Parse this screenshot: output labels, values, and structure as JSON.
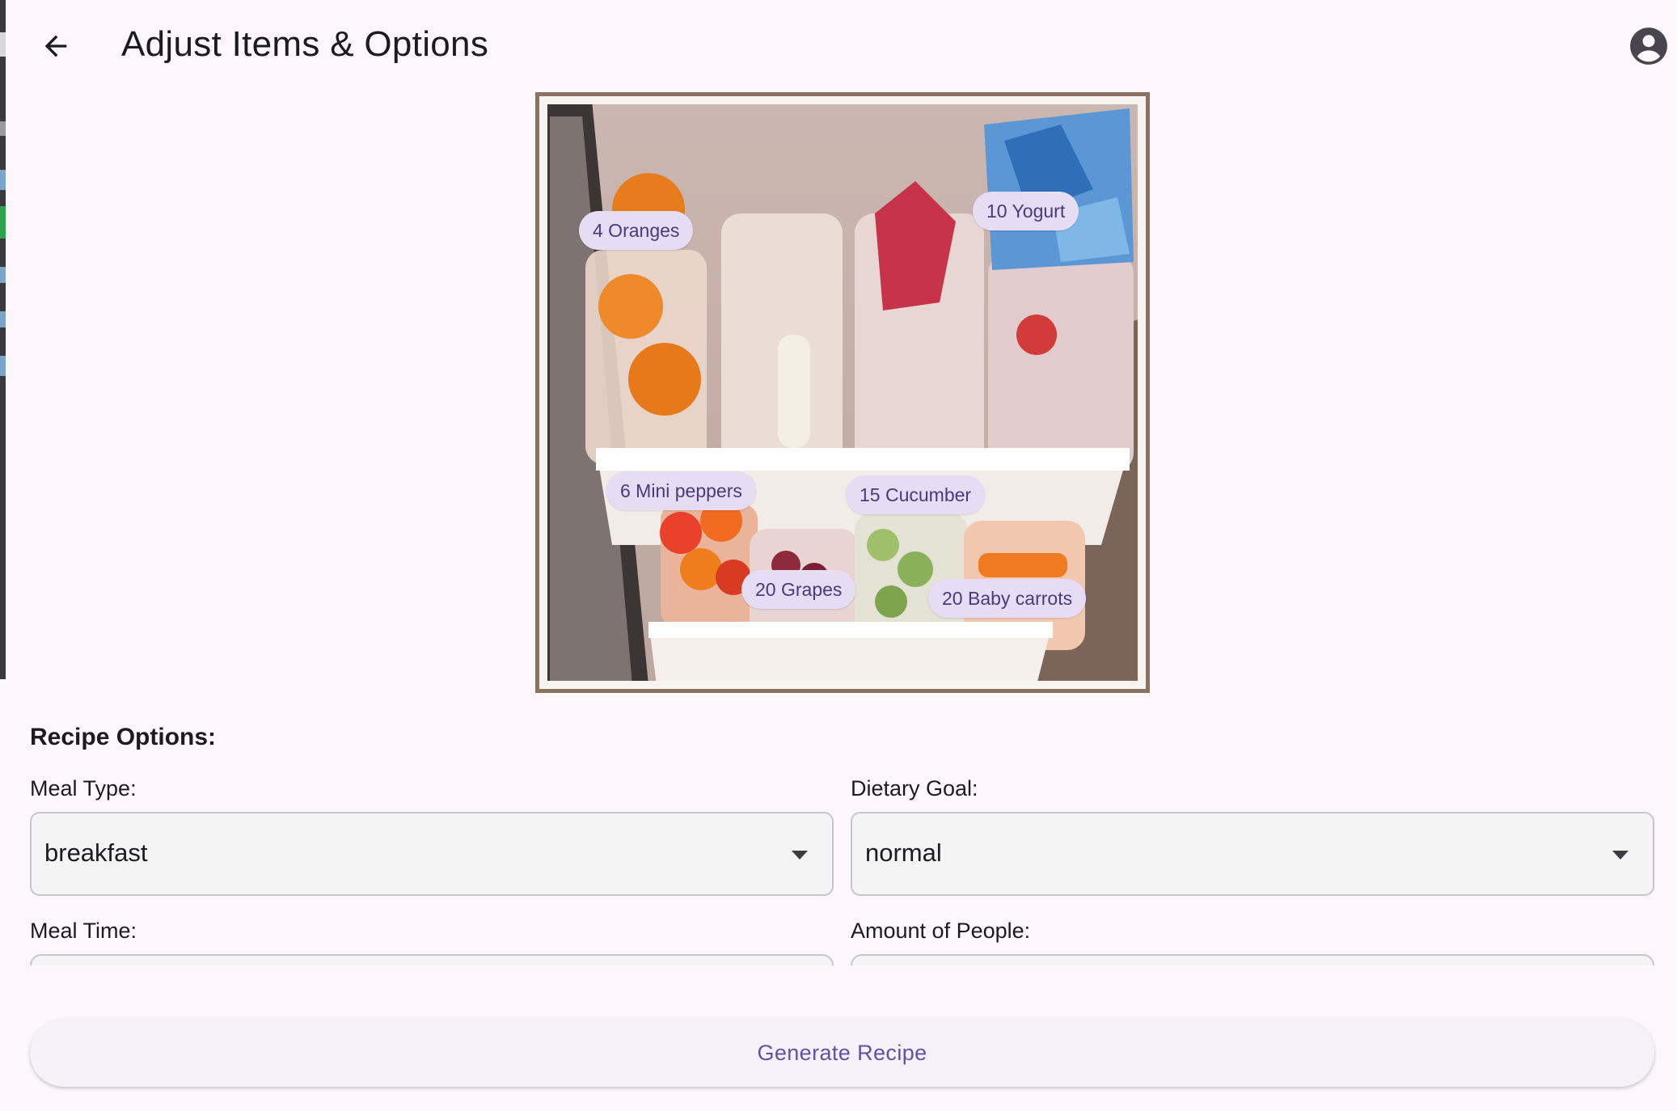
{
  "app_bar": {
    "title": "Adjust Items & Options",
    "back_icon": "arrow-back-icon",
    "account_icon": "account-circle-icon"
  },
  "detected_items": [
    {
      "label": "4 Oranges"
    },
    {
      "label": "10 Yogurt"
    },
    {
      "label": "6 Mini peppers"
    },
    {
      "label": "15 Cucumber"
    },
    {
      "label": "20 Grapes"
    },
    {
      "label": "20 Baby carrots"
    }
  ],
  "recipe_options": {
    "title": "Recipe Options:",
    "meal_type": {
      "label": "Meal Type:",
      "value": "breakfast"
    },
    "dietary_goal": {
      "label": "Dietary Goal:",
      "value": "normal"
    },
    "meal_time": {
      "label": "Meal Time:"
    },
    "amount_of_people": {
      "label": "Amount of People:"
    }
  },
  "actions": {
    "generate_label": "Generate Recipe"
  },
  "colors": {
    "background": "#fdf7fc",
    "chip_background": "#e6dcf4",
    "chip_text": "#4a3a7a",
    "primary": "#6750a4"
  }
}
